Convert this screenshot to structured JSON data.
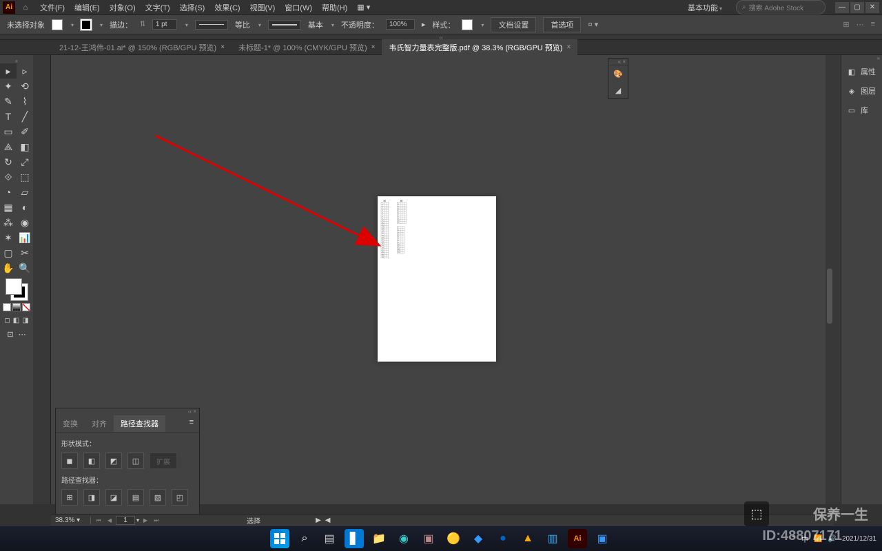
{
  "app": {
    "logo": "Ai"
  },
  "menu": [
    "文件(F)",
    "编辑(E)",
    "对象(O)",
    "文字(T)",
    "选择(S)",
    "效果(C)",
    "视图(V)",
    "窗口(W)",
    "帮助(H)"
  ],
  "titlebar": {
    "workspace": "基本功能",
    "search_placeholder": "搜索 Adobe Stock"
  },
  "controlbar": {
    "selection_state": "未选择对象",
    "stroke_label": "描边：",
    "stroke_weight": "1 pt",
    "uniform_label": "等比",
    "basic_label": "基本",
    "opacity_label": "不透明度：",
    "opacity_value": "100%",
    "style_label": "样式：",
    "doc_setup": "文档设置",
    "prefs": "首选项"
  },
  "tabs": [
    {
      "label": "21-12-王鸿伟-01.ai* @ 150% (RGB/GPU 预览)",
      "active": false
    },
    {
      "label": "未标题-1* @ 100% (CMYK/GPU 预览)",
      "active": false
    },
    {
      "label": "韦氏智力量表完整版.pdf @ 38.3% (RGB/GPU 预览)",
      "active": true
    }
  ],
  "right_panel": [
    {
      "icon": "◧",
      "label": "属性"
    },
    {
      "icon": "◈",
      "label": "图层"
    },
    {
      "icon": "▭",
      "label": "库"
    }
  ],
  "pathfinder": {
    "tabs": [
      "变换",
      "对齐",
      "路径查找器"
    ],
    "active_tab": 2,
    "shape_modes_label": "形状模式：",
    "expand_label": "扩展",
    "pathfinders_label": "路径查找器："
  },
  "statusbar": {
    "zoom": "38.3%",
    "page": "1",
    "tool_status": "选择"
  },
  "taskbar": {
    "time": "2021/12/31",
    "ime": "中",
    "wm_text": "保养一生",
    "wm_id": "ID:48807171"
  }
}
